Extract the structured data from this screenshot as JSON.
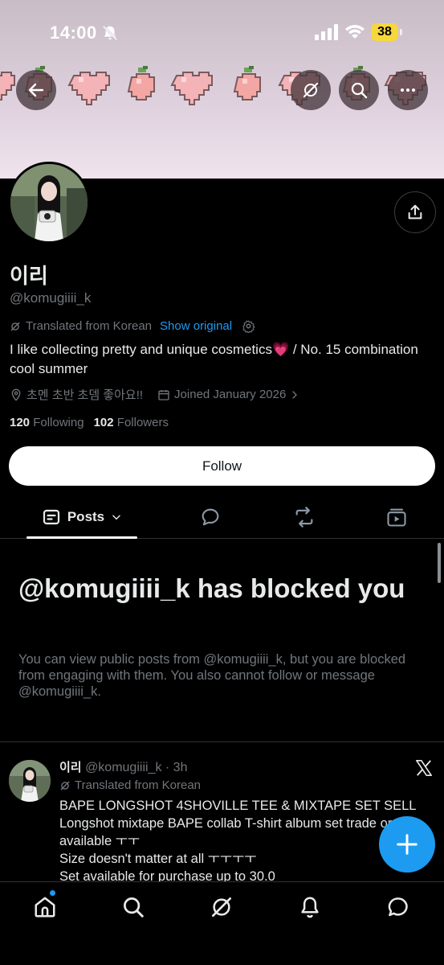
{
  "status_bar": {
    "time": "14:00",
    "battery": "38"
  },
  "header": {
    "back_icon": "arrow-left-icon",
    "grok_icon": "grok-icon",
    "search_icon": "search-icon",
    "more_icon": "more-icon",
    "share_icon": "share-icon"
  },
  "profile": {
    "display_name": "이리",
    "handle": "@komugiiii_k",
    "translated_label": "Translated from Korean",
    "show_original": "Show original",
    "bio_part1": "I like collecting pretty and unique cosmetics",
    "bio_emoji": "💗",
    "bio_part2": " / No. 15 combination cool summer",
    "location": "초멘 초반 초뎀 좋아요!!",
    "joined": "Joined January 2026",
    "following_count": "120",
    "following_label": "Following",
    "followers_count": "102",
    "followers_label": "Followers",
    "follow_button": "Follow"
  },
  "tabs": {
    "posts_label": "Posts"
  },
  "blocked": {
    "title": "@komugiiii_k has blocked you",
    "description": "You can view public posts from @komugiiii_k, but you are blocked from engaging with them. You also cannot follow or message @komugiiii_k."
  },
  "post": {
    "name": "이리",
    "handle": "@komugiiii_k",
    "separator": " · ",
    "time": "3h",
    "translated_label": "Translated from Korean",
    "body": "BAPE LONGSHOT 4SHOVILLE TEE & MIXTAPE SET SELL\nLongshot mixtape BAPE collab T-shirt album set trade or available ㅜㅜ\nSize doesn't matter at all ㅜㅜㅜㅜ\nSet available for purchase up to 30.0"
  },
  "colors": {
    "accent": "#1d9bf0",
    "background": "#000000",
    "text_primary": "#e7e9ea",
    "text_secondary": "#71767b",
    "battery": "#f6d73c"
  }
}
